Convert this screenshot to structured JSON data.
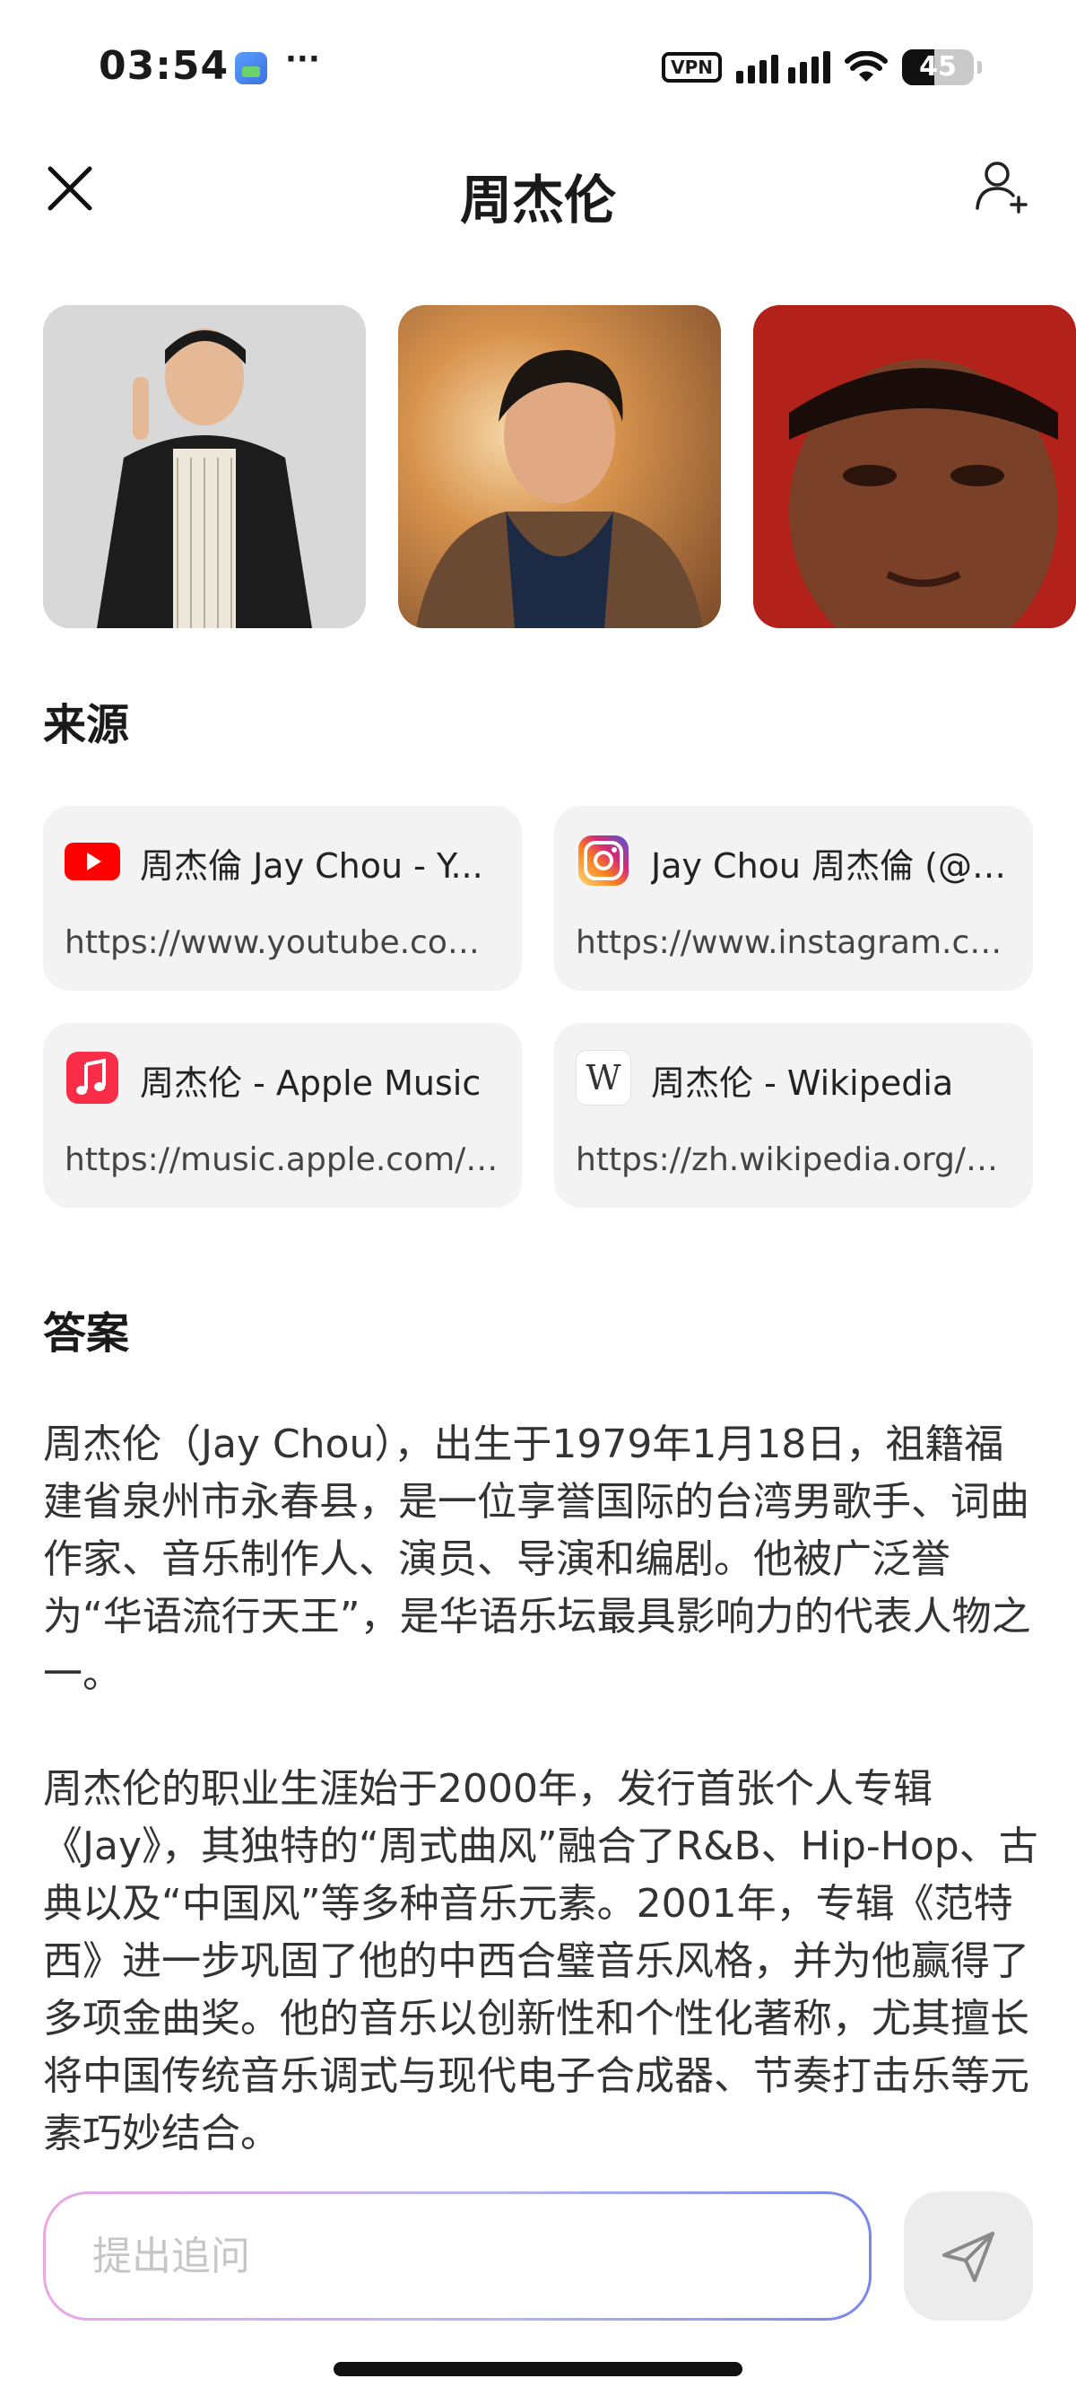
{
  "status_bar": {
    "time": "03:54",
    "dots": "···",
    "vpn_label": "VPN",
    "battery_level": "45",
    "battery_fraction": 0.45
  },
  "header": {
    "title": "周杰伦",
    "close_icon": "close-icon",
    "add_icon": "add-person-icon"
  },
  "images": [
    {
      "name": "image-1",
      "color": "#d6d6d6"
    },
    {
      "name": "image-2",
      "color": "#c8823f"
    },
    {
      "name": "image-3",
      "color": "#b22018"
    }
  ],
  "sources": {
    "heading": "来源",
    "items": [
      {
        "icon": "youtube-icon",
        "title": "周杰倫 Jay Chou - Y...",
        "url": "https://www.youtube.com/...",
        "color": "#ff0000"
      },
      {
        "icon": "instagram-icon",
        "title": "Jay Chou 周杰倫 (@j...",
        "url": "https://www.instagram.co...",
        "color": "#d62976"
      },
      {
        "icon": "apple-music-icon",
        "title": "周杰伦 - Apple Music",
        "url": "https://music.apple.com/c...",
        "color": "#fa2d48"
      },
      {
        "icon": "wikipedia-icon",
        "title": "周杰伦 - Wikipedia",
        "url": "https://zh.wikipedia.org/wi...",
        "color": "#333333"
      }
    ]
  },
  "answer": {
    "heading": "答案",
    "paragraphs": [
      "周杰伦（Jay Chou），出生于1979年1月18日，祖籍福建省泉州市永春县，是一位享誉国际的台湾男歌手、词曲作家、音乐制作人、演员、导演和编剧。他被广泛誉为“华语流行天王”，是华语乐坛最具影响力的代表人物之一。",
      "周杰伦的职业生涯始于2000年，发行首张个人专辑《Jay》，其独特的“周式曲风”融合了R&B、Hip-Hop、古典以及“中国风”等多种音乐元素。2001年，专辑《范特西》进一步巩固了他的中西合璧音乐风格，并为他赢得了多项金曲奖。他的音乐以创新性和个性化著称，尤其擅长将中国传统音乐调式与现代电子合成器、节奏打击乐等元素巧妙结合。"
    ]
  },
  "input": {
    "placeholder": "提出追问",
    "value": ""
  },
  "send_icon": "send-icon",
  "wikipedia_glyph": "W"
}
